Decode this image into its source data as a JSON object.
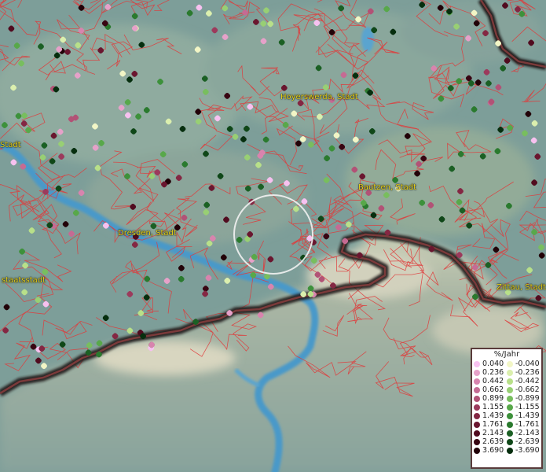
{
  "cities": [
    {
      "name": "Hoyerswerda, Stadt"
    },
    {
      "name": "Bautzen, Stadt"
    },
    {
      "name": "Dresden, Stadt"
    },
    {
      "name": "Zittau, Stadt"
    },
    {
      "name": "Stadt"
    },
    {
      "name": "staatsstadt"
    }
  ],
  "legend": {
    "title": "%/Jahr",
    "rows": [
      {
        "pos": "0.040",
        "pos_color": "#f7c1f0",
        "neg": "-0.040",
        "neg_color": "#f2f6c6"
      },
      {
        "pos": "0.236",
        "pos_color": "#e6a1c9",
        "neg": "-0.236",
        "neg_color": "#dbefae"
      },
      {
        "pos": "0.442",
        "pos_color": "#d884ae",
        "neg": "-0.442",
        "neg_color": "#b8e089"
      },
      {
        "pos": "0.662",
        "pos_color": "#c56b93",
        "neg": "-0.662",
        "neg_color": "#98cf74"
      },
      {
        "pos": "0.899",
        "pos_color": "#b25276",
        "neg": "-0.899",
        "neg_color": "#78be5e"
      },
      {
        "pos": "1.155",
        "pos_color": "#9c3a5c",
        "neg": "-1.155",
        "neg_color": "#58a84a"
      },
      {
        "pos": "1.439",
        "pos_color": "#842743",
        "neg": "-1.439",
        "neg_color": "#3d913b"
      },
      {
        "pos": "1.761",
        "pos_color": "#6a162f",
        "neg": "-1.761",
        "neg_color": "#2a7a2e"
      },
      {
        "pos": "2.143",
        "pos_color": "#510b1f",
        "neg": "-2.143",
        "neg_color": "#1b6024"
      },
      {
        "pos": "2.639",
        "pos_color": "#380512",
        "neg": "-2.639",
        "neg_color": "#0f4718"
      },
      {
        "pos": "3.690",
        "pos_color": "#220208",
        "neg": "-3.690",
        "neg_color": "#062e0e"
      }
    ]
  }
}
